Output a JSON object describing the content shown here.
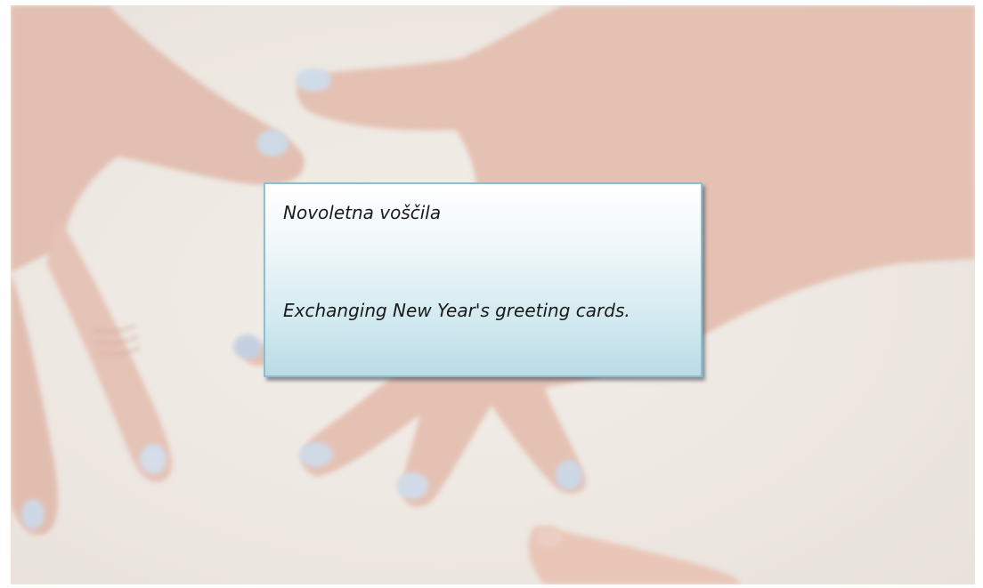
{
  "caption": {
    "title": "Novoletna voščila",
    "body": "Exchanging New Year's greeting cards."
  },
  "colors": {
    "box_border": "#8fbfcf",
    "box_gradient_top": "#ffffff",
    "box_gradient_bottom": "#b9dbe6",
    "background_surface": "#ede5de",
    "skin": "#e3b8a6",
    "nail_polish": "#c4d2e2"
  }
}
